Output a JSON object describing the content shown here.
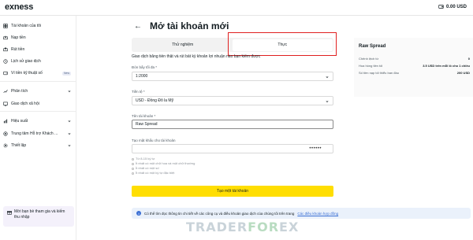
{
  "topbar": {
    "logo": "exness",
    "balance": "0.00 USD"
  },
  "sidebar": {
    "items": [
      {
        "label": "Tài khoản của tôi",
        "icon": "grid-icon"
      },
      {
        "label": "Nạp tiền",
        "icon": "deposit-icon"
      },
      {
        "label": "Rút tiền",
        "icon": "withdraw-icon"
      },
      {
        "label": "Lịch sử giao dịch",
        "icon": "history-icon"
      },
      {
        "label": "Ví tiền kỹ thuật số",
        "icon": "wallet-icon",
        "badge": "New"
      },
      {
        "label": "Phân tích",
        "icon": "analytics-icon",
        "expandable": true
      },
      {
        "label": "Giao dịch xã hội",
        "icon": "social-icon"
      },
      {
        "label": "Hiệu suất",
        "icon": "performance-icon",
        "expandable": true
      },
      {
        "label": "Trung tâm Hỗ trợ Khách ...",
        "icon": "support-icon",
        "expandable": true
      },
      {
        "label": "Thiết lập",
        "icon": "settings-icon",
        "expandable": true
      }
    ],
    "promo": "Mời bạn bè tham gia và kiếm thu nhập"
  },
  "main": {
    "title": "Mở tài khoản mới",
    "tabs": [
      {
        "label": "Thử nghiệm",
        "active": false
      },
      {
        "label": "Thực",
        "active": true
      }
    ],
    "description": "Giao dịch bằng tiền thật và rút bất kỳ khoản lợi nhuận nào bạn kiếm được",
    "leverage": {
      "label": "Đòn bẩy tối đa *",
      "value": "1:2000"
    },
    "currency": {
      "label": "Tiền tệ *",
      "value": "USD - Đồng Đô la Mỹ"
    },
    "nickname": {
      "label": "Tên tài khoản *",
      "value": "Raw Spread"
    },
    "password": {
      "label": "Tạo mật khẩu cho tài khoản",
      "value": "••••••"
    },
    "rules": [
      "Từ 8-15 ký tự",
      "Ít nhất có một chữ hoa và một chữ thường",
      "Ít nhất có một số",
      "Ít nhất có một ký tự đặc biệt"
    ],
    "submit_label": "Tạo một tài khoản",
    "info_text": "Có thể tìm đọc thông tin chi tiết về các công cụ và điều khoản giao dịch của chúng tôi trên trang",
    "info_link": "Các điều khoản hợp đồng"
  },
  "summary": {
    "title": "Raw Spread",
    "rows": [
      {
        "label": "Chênh lệch từ",
        "value": "0"
      },
      {
        "label": "Hoa hồng tiền tối",
        "value": "3.5 USD trên mỗi lô cho 1 chiều"
      },
      {
        "label": "Số tiền nạp tối thiểu ban đầu",
        "value": "200 USD"
      }
    ]
  },
  "watermark": {
    "part1": "TRADER",
    "part2": "FOR",
    "part3": "EX"
  },
  "colors": {
    "accent": "#ffde02",
    "highlight": "#e02020",
    "link": "#3b6fd4"
  }
}
